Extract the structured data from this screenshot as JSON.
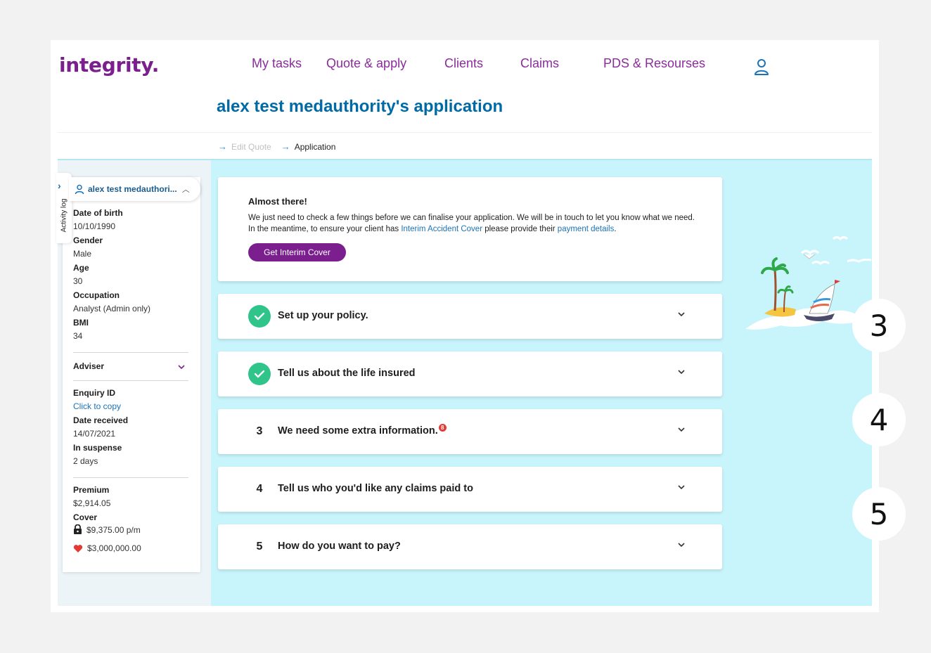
{
  "header": {
    "logo": "integrity.",
    "nav": [
      "My tasks",
      "Quote & apply",
      "Clients",
      "Claims",
      "PDS & Resourses"
    ],
    "user_icon": "user-icon"
  },
  "page": {
    "title": "alex test medauthority's application"
  },
  "breadcrumb": {
    "items": [
      "Edit Quote",
      "Application"
    ]
  },
  "side_tab": {
    "label": "Activity log"
  },
  "sidebar": {
    "client_name": "alex test medauthori...",
    "dob_label": "Date of birth",
    "dob": "10/10/1990",
    "gender_label": "Gender",
    "gender": "Male",
    "age_label": "Age",
    "age": "30",
    "occupation_label": "Occupation",
    "occupation": "Analyst (Admin only)",
    "bmi_label": "BMI",
    "bmi": "34",
    "adviser_label": "Adviser",
    "enquiry_label": "Enquiry ID",
    "enquiry_link": "Click to copy",
    "date_received_label": "Date received",
    "date_received": "14/07/2021",
    "suspense_label": "In suspense",
    "suspense": "2 days",
    "premium_label": "Premium",
    "premium": "$2,914.05",
    "cover_label": "Cover",
    "cover_income": "$9,375.00 p/m",
    "cover_life": "$3,000,000.00"
  },
  "message": {
    "title": "Almost there!",
    "body_1": "We just need to check a few things before we can finalise your application. We will be in touch to let you know what we need. In the meantime, to ensure your client has ",
    "link_1": "Interim Accident Cover",
    "body_2": " please provide their ",
    "link_2": "payment details",
    "body_3": ".",
    "button": "Get Interim Cover"
  },
  "steps": [
    {
      "marker": "check",
      "title": "Set up your policy."
    },
    {
      "marker": "check",
      "title": "Tell us about the life insured"
    },
    {
      "marker": "3",
      "title": "We need some extra information.",
      "alert": "8"
    },
    {
      "marker": "4",
      "title": "Tell us who you'd like any claims paid to"
    },
    {
      "marker": "5",
      "title": "How do you want to pay?"
    }
  ],
  "badges": [
    "3",
    "4",
    "5"
  ],
  "colors": {
    "brand_purple": "#7b1f8e",
    "title_blue": "#006aa6",
    "background_cyan": "#c8f4fb",
    "success_green": "#2ec48a",
    "alert_red": "#e53935"
  }
}
